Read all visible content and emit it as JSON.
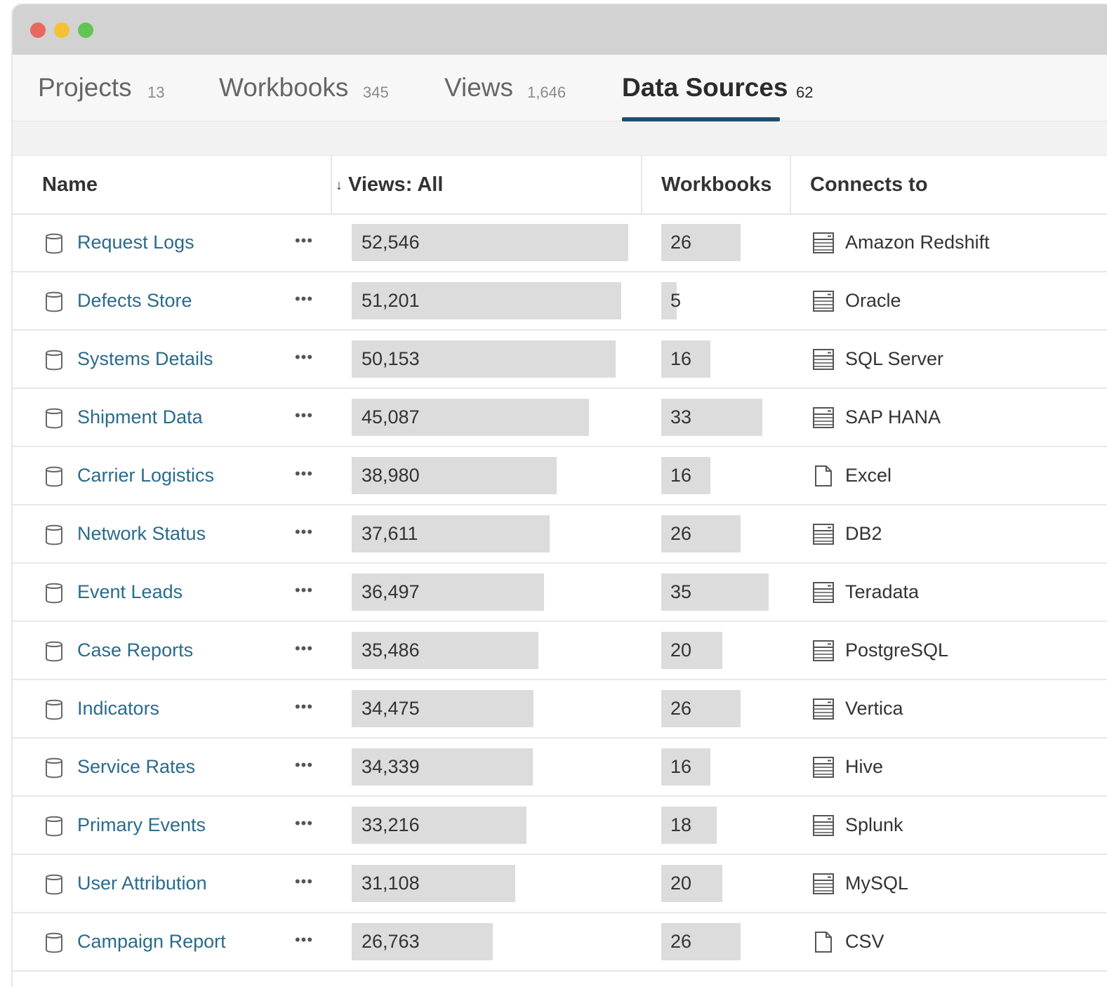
{
  "tabs": [
    {
      "label": "Projects",
      "count": "13"
    },
    {
      "label": "Workbooks",
      "count": "345"
    },
    {
      "label": "Views",
      "count": "1,646"
    },
    {
      "label": "Data Sources",
      "count": "62"
    }
  ],
  "active_tab": "Data Sources",
  "table": {
    "headers": {
      "name": "Name",
      "sort_arrow": "↓",
      "views": "Views: All",
      "workbooks": "Workbooks",
      "connects_to": "Connects to"
    },
    "views_bar_scale_max": 56000,
    "workbooks_bar_scale_max": 38.5,
    "more_label": "•••",
    "rows": [
      {
        "name": "Request Logs",
        "views": "52,546",
        "views_value": 52546,
        "workbooks": "26",
        "workbooks_value": 26,
        "connects_to": "Amazon Redshift",
        "connector_icon": "database-server-icon"
      },
      {
        "name": "Defects Store",
        "views": "51,201",
        "views_value": 51201,
        "workbooks": "5",
        "workbooks_value": 5,
        "connects_to": "Oracle",
        "connector_icon": "database-server-icon"
      },
      {
        "name": "Systems Details",
        "views": "50,153",
        "views_value": 50153,
        "workbooks": "16",
        "workbooks_value": 16,
        "connects_to": "SQL Server",
        "connector_icon": "database-server-icon"
      },
      {
        "name": "Shipment Data",
        "views": "45,087",
        "views_value": 45087,
        "workbooks": "33",
        "workbooks_value": 33,
        "connects_to": "SAP HANA",
        "connector_icon": "database-server-icon"
      },
      {
        "name": "Carrier Logistics",
        "views": "38,980",
        "views_value": 38980,
        "workbooks": "16",
        "workbooks_value": 16,
        "connects_to": "Excel",
        "connector_icon": "file-icon"
      },
      {
        "name": "Network Status",
        "views": "37,611",
        "views_value": 37611,
        "workbooks": "26",
        "workbooks_value": 26,
        "connects_to": "DB2",
        "connector_icon": "database-server-icon"
      },
      {
        "name": "Event Leads",
        "views": "36,497",
        "views_value": 36497,
        "workbooks": "35",
        "workbooks_value": 35,
        "connects_to": "Teradata",
        "connector_icon": "database-server-icon"
      },
      {
        "name": "Case Reports",
        "views": "35,486",
        "views_value": 35486,
        "workbooks": "20",
        "workbooks_value": 20,
        "connects_to": "PostgreSQL",
        "connector_icon": "database-server-icon"
      },
      {
        "name": "Indicators",
        "views": "34,475",
        "views_value": 34475,
        "workbooks": "26",
        "workbooks_value": 26,
        "connects_to": "Vertica",
        "connector_icon": "database-server-icon"
      },
      {
        "name": "Service Rates",
        "views": "34,339",
        "views_value": 34339,
        "workbooks": "16",
        "workbooks_value": 16,
        "connects_to": "Hive",
        "connector_icon": "database-server-icon"
      },
      {
        "name": "Primary Events",
        "views": "33,216",
        "views_value": 33216,
        "workbooks": "18",
        "workbooks_value": 18,
        "connects_to": "Splunk",
        "connector_icon": "database-server-icon"
      },
      {
        "name": "User Attribution",
        "views": "31,108",
        "views_value": 31108,
        "workbooks": "20",
        "workbooks_value": 20,
        "connects_to": "MySQL",
        "connector_icon": "database-server-icon"
      },
      {
        "name": "Campaign Report",
        "views": "26,763",
        "views_value": 26763,
        "workbooks": "26",
        "workbooks_value": 26,
        "connects_to": "CSV",
        "connector_icon": "file-icon"
      }
    ]
  },
  "colors": {
    "link": "#2a6b8c",
    "bar": "#dcdcdc",
    "active_underline": "#1f4d72"
  }
}
